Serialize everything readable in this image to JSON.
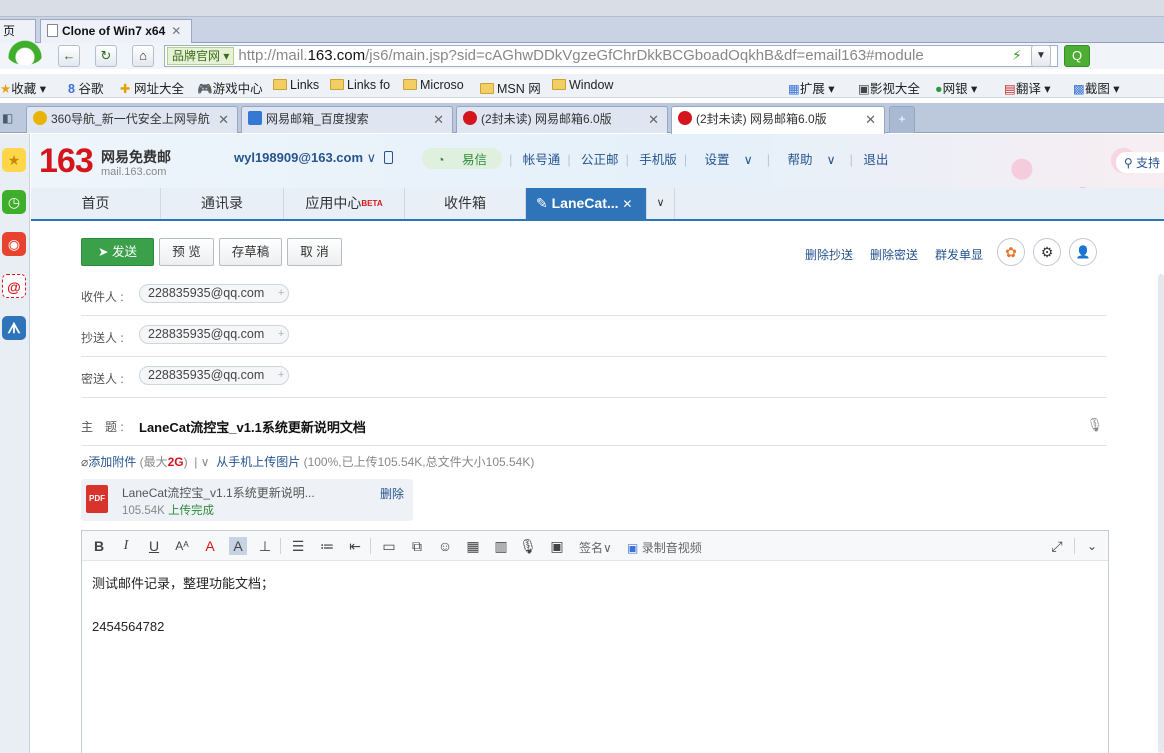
{
  "vm": {
    "tab_partial": "页",
    "tab_title": "Clone of Win7 x64"
  },
  "browser": {
    "brand_pill": "品牌官网",
    "url_prefix": "http://mail.",
    "url_host": "163.com",
    "url_rest": "/js6/main.jsp?sid=cAGhwDDkVgzeGfChrDkkBCGboadOqkhB&df=email163#module",
    "bookmarks": [
      "收藏",
      "谷歌",
      "网址大全",
      "游戏中心",
      "Links",
      "Links fo",
      "Microso",
      "MSN 网",
      "Window"
    ],
    "tools": [
      "扩展",
      "影视大全",
      "网银",
      "翻译",
      "截图"
    ],
    "tabs": [
      {
        "title": "360导航_新一代安全上网导航",
        "active": false
      },
      {
        "title": "网易邮箱_百度搜索",
        "active": false
      },
      {
        "title": "(2封未读) 网易邮箱6.0版",
        "active": false
      },
      {
        "title": "(2封未读) 网易邮箱6.0版",
        "active": true
      }
    ],
    "new_tab": "+"
  },
  "mail": {
    "logo_num": "163",
    "logo_text": "网易免费邮",
    "logo_sub": "mail.163.com",
    "user": "wyl198909@163.com",
    "topnav": {
      "yixin": "易信",
      "items": [
        "帐号通",
        "公正邮",
        "手机版",
        "设置",
        "帮助",
        "退出"
      ]
    },
    "search_label": "支持",
    "tabs": [
      "首页",
      "通讯录",
      "应用中心",
      "收件箱",
      "LaneCat..."
    ],
    "beta": "BETA"
  },
  "compose": {
    "buttons": {
      "send": "发送",
      "preview": "预 览",
      "draft": "存草稿",
      "cancel": "取 消"
    },
    "right_links": [
      "删除抄送",
      "删除密送",
      "群发单显"
    ],
    "to_label": "收件人 :",
    "cc_label": "抄送人 :",
    "bcc_label": "密送人 :",
    "recipient": "228835935@qq.com",
    "subject_label": "主　题 :",
    "subject": "LaneCat流控宝_v1.1系统更新说明文档",
    "attach": {
      "add": "添加附件",
      "max_prefix": "(最大",
      "max_value": "2G",
      "max_suffix": ")",
      "phone": "从手机上传图片",
      "status": "(100%,已上传105.54K,总文件大小105.54K)"
    },
    "file": {
      "badge": "PDF",
      "name": "LaneCat流控宝_v1.1系统更新说明...",
      "size": "105.54K",
      "status": "上传完成",
      "delete": "删除"
    },
    "toolbar_sign": "签名",
    "toolbar_video": "录制音视频",
    "body_line1": "测试邮件记录，整理功能文档；",
    "body_line2": "2454564782"
  }
}
